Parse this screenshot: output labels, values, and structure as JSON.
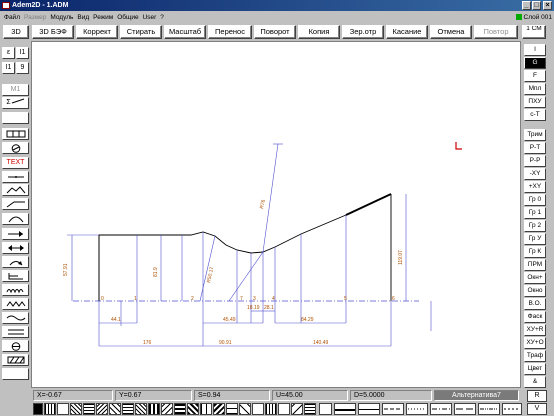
{
  "window": {
    "title": "Adem2D - 1.ADM",
    "minimize": "_",
    "maximize": "□",
    "close": "×"
  },
  "menu": {
    "items": [
      "Файл",
      "Размер",
      "Модуль",
      "Вид",
      "Режим",
      "Общие",
      "User",
      "?"
    ]
  },
  "layer": {
    "label": "Слой 001"
  },
  "toolbar": {
    "items": [
      "3D",
      "3D БЭФ",
      "Коррект",
      "Стирать",
      "Масштаб",
      "Перенос",
      "Поворот",
      "Копия",
      "Зер.отр",
      "Касание",
      "Отмена",
      "Повтор"
    ],
    "right_label": "1 СМ"
  },
  "left_tools": {
    "rows": [
      [
        "ε",
        "I1"
      ],
      [
        "I1",
        "9"
      ]
    ],
    "m1": "М1",
    "sigma": "Σ",
    "text": "TEXT"
  },
  "right_tools": {
    "items": [
      "I",
      "G",
      "F",
      "Мпл",
      "ПХУ",
      "с-Т",
      "Трим",
      "Р-Т",
      "Р-Р",
      "-XY",
      "+XY",
      "Гр 0",
      "Гр 1",
      "Гр 2",
      "Гр У",
      "Гр К",
      "ПРМ",
      "Окн+",
      "Окно",
      "В.О.",
      "Фаск",
      "ХУ+R",
      "ХУ+О",
      "Траф",
      "Цвет",
      "&"
    ]
  },
  "status": {
    "x": "X=-0.67",
    "y": "Y=0.67",
    "s": "S=0.94",
    "u": "U=45.00",
    "d": "D=5.0000",
    "alt": "Альтернатива7"
  },
  "corner": {
    "r": "R",
    "v": "V"
  },
  "colors": {
    "dimension": "#b05000",
    "axis": "#5050d0",
    "outline": "#000000",
    "marker": "#d00000"
  },
  "drawing": {
    "dims": {
      "d1": "57.91",
      "d2": "81.9",
      "d3": "R50.17",
      "d4": "R76",
      "d5": "119.07",
      "d6": "44.1",
      "d7": "176",
      "d8": "90.91",
      "d9": "45.49",
      "d10": "140.49",
      "d11": "18.19",
      "d12": "28.1",
      "d13": "84.29"
    },
    "points": [
      "0",
      "1",
      "2",
      "7",
      "3",
      "4",
      "5",
      "6"
    ]
  }
}
